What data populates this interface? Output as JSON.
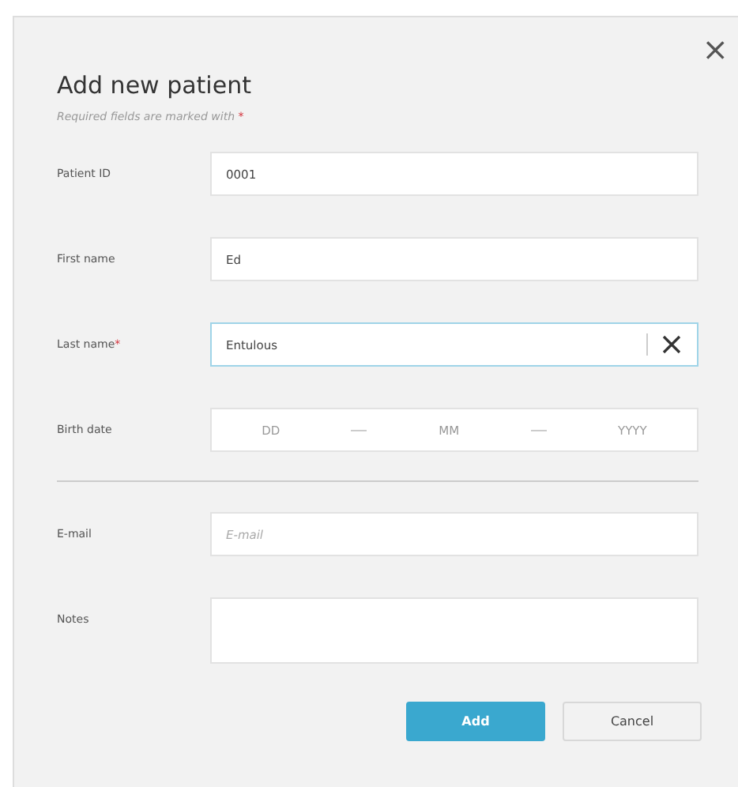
{
  "dialog": {
    "title": "Add new patient",
    "note": "Required fields are marked with",
    "required_mark": "*",
    "close_glyph": "×"
  },
  "fields": [
    {
      "kind": "text",
      "label": "Patient ID",
      "value": "0001"
    },
    {
      "kind": "text",
      "label": "First name",
      "value": "Ed"
    },
    {
      "kind": "text",
      "label": "Last name",
      "required": true,
      "focused": true,
      "value": "Entulous",
      "clearable": true
    },
    {
      "kind": "date",
      "label": "Birth date",
      "parts": [
        "DD",
        "MM",
        "YYYY"
      ]
    },
    {
      "kind": "divider"
    },
    {
      "kind": "text",
      "label": "E-mail",
      "placeholder": "E-mail"
    },
    {
      "kind": "textarea",
      "label": "Notes"
    }
  ],
  "buttons": [
    {
      "label": "Add",
      "primary": true
    },
    {
      "label": "Cancel",
      "primary": false
    }
  ]
}
